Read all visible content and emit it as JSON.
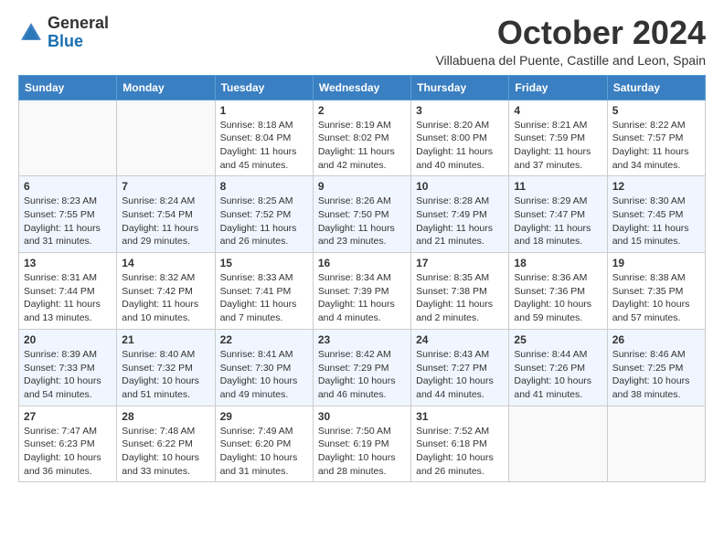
{
  "header": {
    "logo_general": "General",
    "logo_blue": "Blue",
    "month_title": "October 2024",
    "subtitle": "Villabuena del Puente, Castille and Leon, Spain"
  },
  "days_of_week": [
    "Sunday",
    "Monday",
    "Tuesday",
    "Wednesday",
    "Thursday",
    "Friday",
    "Saturday"
  ],
  "weeks": [
    [
      {
        "day": "",
        "info": ""
      },
      {
        "day": "",
        "info": ""
      },
      {
        "day": "1",
        "info": "Sunrise: 8:18 AM\nSunset: 8:04 PM\nDaylight: 11 hours and 45 minutes."
      },
      {
        "day": "2",
        "info": "Sunrise: 8:19 AM\nSunset: 8:02 PM\nDaylight: 11 hours and 42 minutes."
      },
      {
        "day": "3",
        "info": "Sunrise: 8:20 AM\nSunset: 8:00 PM\nDaylight: 11 hours and 40 minutes."
      },
      {
        "day": "4",
        "info": "Sunrise: 8:21 AM\nSunset: 7:59 PM\nDaylight: 11 hours and 37 minutes."
      },
      {
        "day": "5",
        "info": "Sunrise: 8:22 AM\nSunset: 7:57 PM\nDaylight: 11 hours and 34 minutes."
      }
    ],
    [
      {
        "day": "6",
        "info": "Sunrise: 8:23 AM\nSunset: 7:55 PM\nDaylight: 11 hours and 31 minutes."
      },
      {
        "day": "7",
        "info": "Sunrise: 8:24 AM\nSunset: 7:54 PM\nDaylight: 11 hours and 29 minutes."
      },
      {
        "day": "8",
        "info": "Sunrise: 8:25 AM\nSunset: 7:52 PM\nDaylight: 11 hours and 26 minutes."
      },
      {
        "day": "9",
        "info": "Sunrise: 8:26 AM\nSunset: 7:50 PM\nDaylight: 11 hours and 23 minutes."
      },
      {
        "day": "10",
        "info": "Sunrise: 8:28 AM\nSunset: 7:49 PM\nDaylight: 11 hours and 21 minutes."
      },
      {
        "day": "11",
        "info": "Sunrise: 8:29 AM\nSunset: 7:47 PM\nDaylight: 11 hours and 18 minutes."
      },
      {
        "day": "12",
        "info": "Sunrise: 8:30 AM\nSunset: 7:45 PM\nDaylight: 11 hours and 15 minutes."
      }
    ],
    [
      {
        "day": "13",
        "info": "Sunrise: 8:31 AM\nSunset: 7:44 PM\nDaylight: 11 hours and 13 minutes."
      },
      {
        "day": "14",
        "info": "Sunrise: 8:32 AM\nSunset: 7:42 PM\nDaylight: 11 hours and 10 minutes."
      },
      {
        "day": "15",
        "info": "Sunrise: 8:33 AM\nSunset: 7:41 PM\nDaylight: 11 hours and 7 minutes."
      },
      {
        "day": "16",
        "info": "Sunrise: 8:34 AM\nSunset: 7:39 PM\nDaylight: 11 hours and 4 minutes."
      },
      {
        "day": "17",
        "info": "Sunrise: 8:35 AM\nSunset: 7:38 PM\nDaylight: 11 hours and 2 minutes."
      },
      {
        "day": "18",
        "info": "Sunrise: 8:36 AM\nSunset: 7:36 PM\nDaylight: 10 hours and 59 minutes."
      },
      {
        "day": "19",
        "info": "Sunrise: 8:38 AM\nSunset: 7:35 PM\nDaylight: 10 hours and 57 minutes."
      }
    ],
    [
      {
        "day": "20",
        "info": "Sunrise: 8:39 AM\nSunset: 7:33 PM\nDaylight: 10 hours and 54 minutes."
      },
      {
        "day": "21",
        "info": "Sunrise: 8:40 AM\nSunset: 7:32 PM\nDaylight: 10 hours and 51 minutes."
      },
      {
        "day": "22",
        "info": "Sunrise: 8:41 AM\nSunset: 7:30 PM\nDaylight: 10 hours and 49 minutes."
      },
      {
        "day": "23",
        "info": "Sunrise: 8:42 AM\nSunset: 7:29 PM\nDaylight: 10 hours and 46 minutes."
      },
      {
        "day": "24",
        "info": "Sunrise: 8:43 AM\nSunset: 7:27 PM\nDaylight: 10 hours and 44 minutes."
      },
      {
        "day": "25",
        "info": "Sunrise: 8:44 AM\nSunset: 7:26 PM\nDaylight: 10 hours and 41 minutes."
      },
      {
        "day": "26",
        "info": "Sunrise: 8:46 AM\nSunset: 7:25 PM\nDaylight: 10 hours and 38 minutes."
      }
    ],
    [
      {
        "day": "27",
        "info": "Sunrise: 7:47 AM\nSunset: 6:23 PM\nDaylight: 10 hours and 36 minutes."
      },
      {
        "day": "28",
        "info": "Sunrise: 7:48 AM\nSunset: 6:22 PM\nDaylight: 10 hours and 33 minutes."
      },
      {
        "day": "29",
        "info": "Sunrise: 7:49 AM\nSunset: 6:20 PM\nDaylight: 10 hours and 31 minutes."
      },
      {
        "day": "30",
        "info": "Sunrise: 7:50 AM\nSunset: 6:19 PM\nDaylight: 10 hours and 28 minutes."
      },
      {
        "day": "31",
        "info": "Sunrise: 7:52 AM\nSunset: 6:18 PM\nDaylight: 10 hours and 26 minutes."
      },
      {
        "day": "",
        "info": ""
      },
      {
        "day": "",
        "info": ""
      }
    ]
  ]
}
